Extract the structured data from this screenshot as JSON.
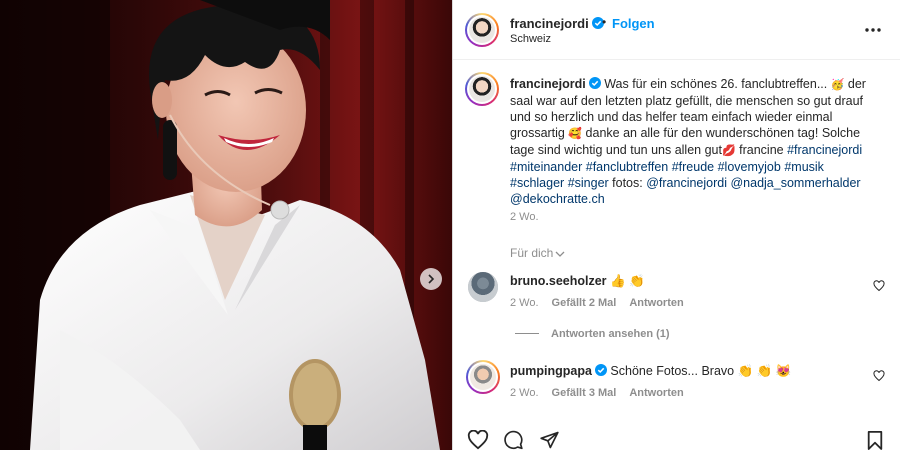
{
  "post": {
    "username": "francinejordi",
    "follow_label": "Folgen",
    "location": "Schweiz",
    "caption": {
      "username": "francinejordi",
      "segments": [
        {
          "type": "text",
          "value": "Was für ein schönes 26. fanclubtreffen... "
        },
        {
          "type": "emoji",
          "value": "🥳"
        },
        {
          "type": "text",
          "value": " der saal war auf den letzten platz gefüllt, die menschen so gut drauf und so herzlich und das helfer team einfach wieder einmal grossartig "
        },
        {
          "type": "emoji",
          "value": "🥰"
        },
        {
          "type": "text",
          "value": " danke an alle für den wunderschönen tag! Solche tage sind wichtig und tun uns allen gut"
        },
        {
          "type": "emoji",
          "value": "💋"
        },
        {
          "type": "text",
          "value": " francine "
        },
        {
          "type": "tag",
          "value": "#francinejordi"
        },
        {
          "type": "text",
          "value": " "
        },
        {
          "type": "tag",
          "value": "#miteinander"
        },
        {
          "type": "text",
          "value": " "
        },
        {
          "type": "tag",
          "value": "#fanclubtreffen"
        },
        {
          "type": "text",
          "value": " "
        },
        {
          "type": "tag",
          "value": "#freude"
        },
        {
          "type": "text",
          "value": " "
        },
        {
          "type": "tag",
          "value": "#lovemyjob"
        },
        {
          "type": "text",
          "value": " "
        },
        {
          "type": "tag",
          "value": "#musik"
        },
        {
          "type": "text",
          "value": " "
        },
        {
          "type": "tag",
          "value": "#schlager"
        },
        {
          "type": "text",
          "value": " "
        },
        {
          "type": "tag",
          "value": "#singer"
        },
        {
          "type": "text",
          "value": " fotos: "
        },
        {
          "type": "tag",
          "value": "@francinejordi"
        },
        {
          "type": "text",
          "value": " "
        },
        {
          "type": "tag",
          "value": "@nadja_sommerhalder"
        },
        {
          "type": "text",
          "value": " "
        },
        {
          "type": "tag",
          "value": "@dekochratte.ch"
        }
      ],
      "time": "2 Wo."
    },
    "for_you_label": "Für dich"
  },
  "comments": [
    {
      "username": "bruno.seeholzer",
      "text": " 👍 👏",
      "time": "2 Wo.",
      "likes": "Gefällt 2 Mal",
      "reply": "Antworten",
      "view_replies": "Antworten ansehen (1)"
    },
    {
      "username": "pumpingpapa",
      "text": " Schöne Fotos... Bravo 👏 👏 😻",
      "time": "2 Wo.",
      "likes": "Gefällt 3 Mal",
      "reply": "Antworten"
    }
  ],
  "icons": {
    "verified": "verified-badge-icon",
    "more": "more-options-icon",
    "carousel": "chevron-right-icon",
    "like": "heart-icon",
    "comment": "comment-icon",
    "share": "share-icon",
    "save": "bookmark-icon"
  },
  "colors": {
    "accent": "#0095f6",
    "link": "#00376b",
    "muted": "#8e8e8e",
    "text": "#262626"
  }
}
